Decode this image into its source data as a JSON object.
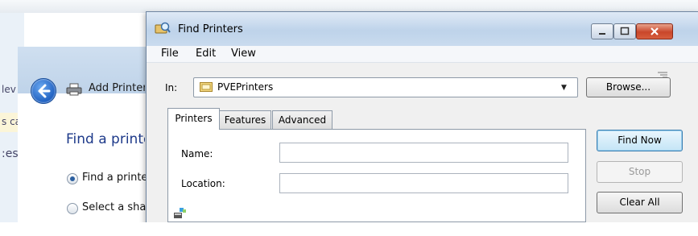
{
  "background": {
    "left_fragment_1": "lev",
    "left_fragment_2": "s ca",
    "left_fragment_3": ":es"
  },
  "wizard": {
    "title": "Add Printer",
    "heading": "Find a printer",
    "options": [
      {
        "label": "Find a printer",
        "selected": true
      },
      {
        "label": "Select a shared printer",
        "selected": false
      }
    ]
  },
  "dialog": {
    "title": "Find Printers",
    "menu": [
      "File",
      "Edit",
      "View"
    ],
    "in_label": "In:",
    "in_value": "PVEPrinters",
    "browse_label": "Browse...",
    "tabs": [
      "Printers",
      "Features",
      "Advanced"
    ],
    "active_tab": "Printers",
    "fields": {
      "name_label": "Name:",
      "name_value": "",
      "location_label": "Location:",
      "location_value": ""
    },
    "buttons": {
      "find_now": "Find Now",
      "stop": "Stop",
      "clear_all": "Clear All"
    }
  },
  "colors": {
    "accent_blue": "#1e5fc0",
    "heading_blue": "#1e3a8a",
    "close_red": "#c9462a"
  },
  "icons": [
    "back-arrow-icon",
    "printer-icon",
    "find-printers-icon",
    "folder-icon",
    "chevron-down-icon",
    "resize-grip-icon",
    "results-icon"
  ]
}
